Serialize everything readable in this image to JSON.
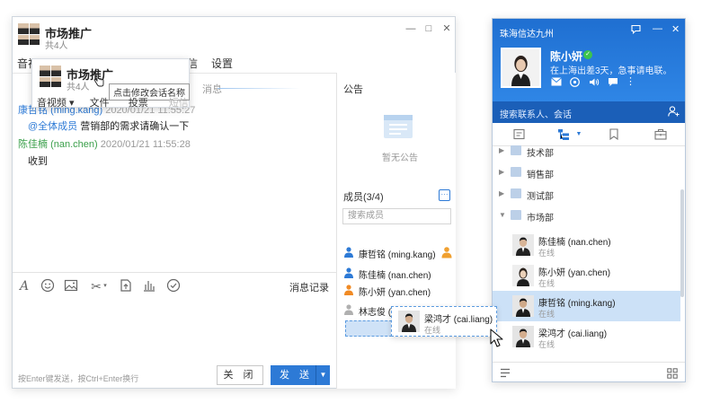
{
  "chat_window": {
    "title": "市场推广",
    "member_count": "共4人",
    "controls": {
      "minimize": "—",
      "maximize": "□",
      "close": "✕"
    },
    "menu": [
      "音视",
      "设置"
    ],
    "messages": [
      {
        "sender": "康哲铭",
        "handle": "(ming.kang)",
        "time": "2020/01/21 11:55:27",
        "text_mention": "@全体成员",
        "text": "营销部的需求请确认一下"
      },
      {
        "sender": "陈佳楠",
        "handle": "(nan.chen)",
        "time": "2020/01/21 11:55:28",
        "text": "收到"
      }
    ],
    "faded_message": "消息",
    "toolbar": {
      "icons": [
        "font-icon",
        "emoji-icon",
        "image-icon",
        "scissors-icon",
        "file-upload-icon",
        "chart-icon",
        "check-circle-icon"
      ],
      "history": "消息记录"
    },
    "input": {
      "hint": "按Enter键发送，按Ctrl+Enter换行",
      "close_label": "关 闭",
      "send_label": "发 送"
    },
    "side": {
      "notice_title": "公告",
      "notice_empty": "暂无公告",
      "members_title": "成员(3/4)",
      "members_more": "···",
      "member_search_placeholder": "搜索成员",
      "members": [
        {
          "name": "康哲铭 (ming.kang)",
          "color": "#2d7ad6",
          "owner": true
        },
        {
          "name": "陈佳楠 (nan.chen)",
          "color": "#2d7ad6",
          "owner": false
        },
        {
          "name": "陈小妍 (yan.chen)",
          "color": "#f08a24",
          "owner": false
        },
        {
          "name": "林志俊 (jun.li)",
          "color": "#b0b0b0",
          "owner": false
        }
      ]
    }
  },
  "rename_popup": {
    "title": "市场推广",
    "count": "共4人",
    "tooltip": "点击修改会话名称",
    "menu": [
      "音视频 ▾",
      "文件",
      "投票",
      "短信"
    ]
  },
  "contact_window": {
    "org_name": "珠海信达九州",
    "user": {
      "name": "陈小妍",
      "signature": "在上海出差3天，急事请电联。"
    },
    "search_placeholder": "搜索联系人、会话",
    "departments": [
      {
        "name": "技术部",
        "expanded": false
      },
      {
        "name": "销售部",
        "expanded": false
      },
      {
        "name": "测试部",
        "expanded": false
      },
      {
        "name": "市场部",
        "expanded": true
      }
    ],
    "contacts": [
      {
        "name": "陈佳楠 (nan.chen)",
        "status": "在线",
        "selected": false
      },
      {
        "name": "陈小妍 (yan.chen)",
        "status": "在线",
        "selected": false
      },
      {
        "name": "康哲铭 (ming.kang)",
        "status": "在线",
        "selected": true
      },
      {
        "name": "梁鸿才 (cai.liang)",
        "status": "在线",
        "selected": false
      }
    ]
  },
  "drag_card": {
    "name": "梁鸿才 (cai.liang)",
    "status": "在线"
  },
  "colors": {
    "accent": "#2d7ad6",
    "sender_blue": "#2d7ad6",
    "sender_green": "#3a9f4a",
    "header_blue": "#2f86e6",
    "selected_row": "#cce1f7"
  }
}
